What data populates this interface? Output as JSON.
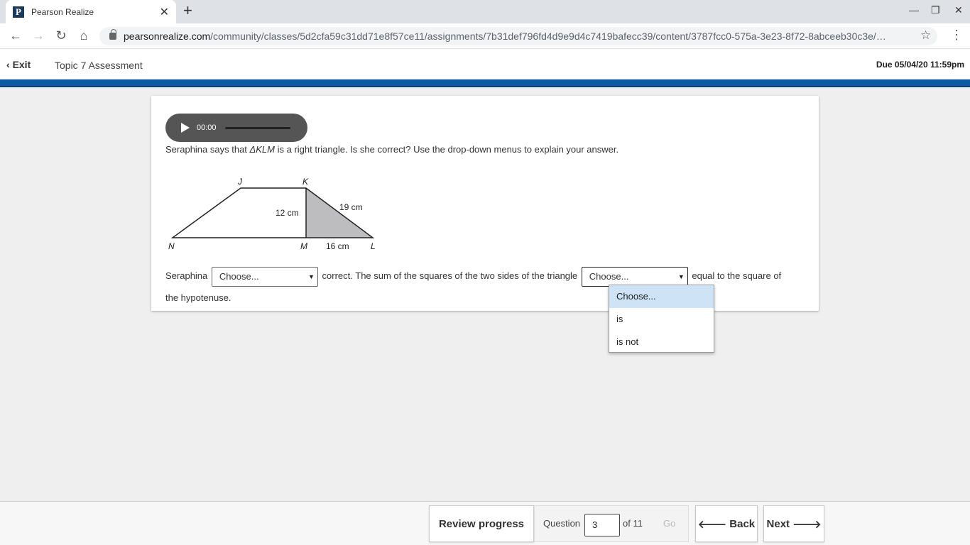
{
  "browser": {
    "tab_title": "Pearson Realize",
    "tab_favicon": "P",
    "url_domain": "pearsonrealize.com",
    "url_path": "/community/classes/5d2cfa59c31dd71e8f57ce11/assignments/7b31def796fd4d9e9d4c7419bafecc39/content/3787fcc0-575a-3e23-8f72-8abceeb30c3e/…"
  },
  "header": {
    "exit_label": "Exit",
    "assignment_title": "Topic 7 Assessment",
    "due": "Due 05/04/20 11:59pm"
  },
  "audio": {
    "time": "00:00"
  },
  "question": {
    "prompt_pre": "Seraphina says that ",
    "prompt_triangle": "ΔKLM",
    "prompt_post": " is a right triangle. Is she correct? Use the drop-down menus to explain your answer.",
    "figure": {
      "labels": {
        "J": "J",
        "K": "K",
        "N": "N",
        "M": "M",
        "L": "L"
      },
      "km_length": "12 cm",
      "kl_length": "19 cm",
      "ml_length": "16 cm",
      "shade_color": "#bdbdbf"
    },
    "answer_part1": "Seraphina",
    "answer_part2": "correct. The sum of the squares of the two sides of the triangle",
    "answer_part3": "equal to the square of the hypotenuse.",
    "select1_value": "Choose...",
    "select2_value": "Choose...",
    "dropdown_options": [
      "Choose...",
      "is",
      "is not"
    ]
  },
  "footer": {
    "review_label": "Review progress",
    "question_label": "Question",
    "question_number": "3",
    "question_total": "of 11",
    "go_label": "Go",
    "back_label": "Back",
    "next_label": "Next"
  },
  "colors": {
    "accent_blue": "#0c5aa6"
  }
}
